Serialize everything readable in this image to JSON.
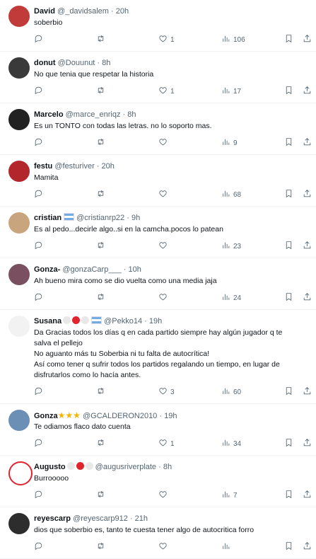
{
  "tweets": [
    {
      "name": "David",
      "handle": "@_davidsalem",
      "time": "20h",
      "text": "soberbio",
      "likes": "1",
      "views": "106",
      "emoji": [],
      "flag": false,
      "stars": false,
      "avatar": "#c23b3b"
    },
    {
      "name": "donut",
      "handle": "@Douunut",
      "time": "8h",
      "text": "No que tenia que respetar la historia",
      "likes": "1",
      "views": "17",
      "emoji": [],
      "flag": false,
      "stars": false,
      "avatar": "#3a3a3a"
    },
    {
      "name": "Marcelo",
      "handle": "@marce_enriqz",
      "time": "8h",
      "text": "Es un TONTO con todas las letras. no lo soporto mas.",
      "likes": "",
      "views": "9",
      "emoji": [],
      "flag": false,
      "stars": false,
      "avatar": "#222222"
    },
    {
      "name": "festu",
      "handle": "@festuriver",
      "time": "20h",
      "text": "Mamita",
      "likes": "",
      "views": "68",
      "emoji": [],
      "flag": false,
      "stars": false,
      "avatar": "#b3262c"
    },
    {
      "name": "cristian",
      "handle": "@cristianrp22",
      "time": "9h",
      "text": "Es al pedo...decirle algo..si en la camcha.pocos lo patean",
      "likes": "",
      "views": "23",
      "emoji": [],
      "flag": true,
      "stars": false,
      "avatar": "#c9a57e"
    },
    {
      "name": "Gonza-",
      "handle": "@gonzaCarp___",
      "time": "10h",
      "text": "Ah bueno mira como se dio vuelta como una media jaja",
      "likes": "",
      "views": "24",
      "emoji": [],
      "flag": false,
      "stars": false,
      "avatar": "#7a5060"
    },
    {
      "name": "Susana",
      "handle": "@Pekko14",
      "time": "19h",
      "text": "Da Gracias todos los días q en cada partido siempre hay algún jugador q te salva el pellejo\nNo aguanto más tu Soberbia ni tu falta de autocrítica!\nAsí como tener q sufrir todos los partidos regalando un tiempo, en lugar de disfrutarlos como lo hacía antes.",
      "likes": "3",
      "views": "60",
      "emoji": [
        "#e8e8e8",
        "#e0242f",
        "#e8e8e8"
      ],
      "flag": true,
      "stars": false,
      "avatar": "#f2f2f2"
    },
    {
      "name": "Gonza",
      "handle": "@GCALDERON2010",
      "time": "19h",
      "text": "Te odiamos flaco dato cuenta",
      "likes": "1",
      "views": "34",
      "emoji": [],
      "flag": false,
      "stars": true,
      "avatar": "#6b8fb5"
    },
    {
      "name": "Augusto",
      "handle": "@augusriverplate",
      "time": "8h",
      "text": "Burrooooo",
      "likes": "",
      "views": "7",
      "emoji": [
        "#e8e8e8",
        "#e0242f",
        "#e8e8e8"
      ],
      "flag": false,
      "stars": false,
      "avatar": "#ffffff"
    },
    {
      "name": "reyescarp",
      "handle": "@reyescarp912",
      "time": "21h",
      "text": "dios que soberbio es, tanto te cuesta tener algo de autocritica forro",
      "likes": "",
      "views": "",
      "emoji": [],
      "flag": false,
      "stars": false,
      "avatar": "#2d2d2d"
    }
  ],
  "icons": {
    "reply": "reply-icon",
    "retweet": "retweet-icon",
    "like": "like-icon",
    "views": "views-icon",
    "bookmark": "bookmark-icon",
    "share": "share-icon"
  }
}
